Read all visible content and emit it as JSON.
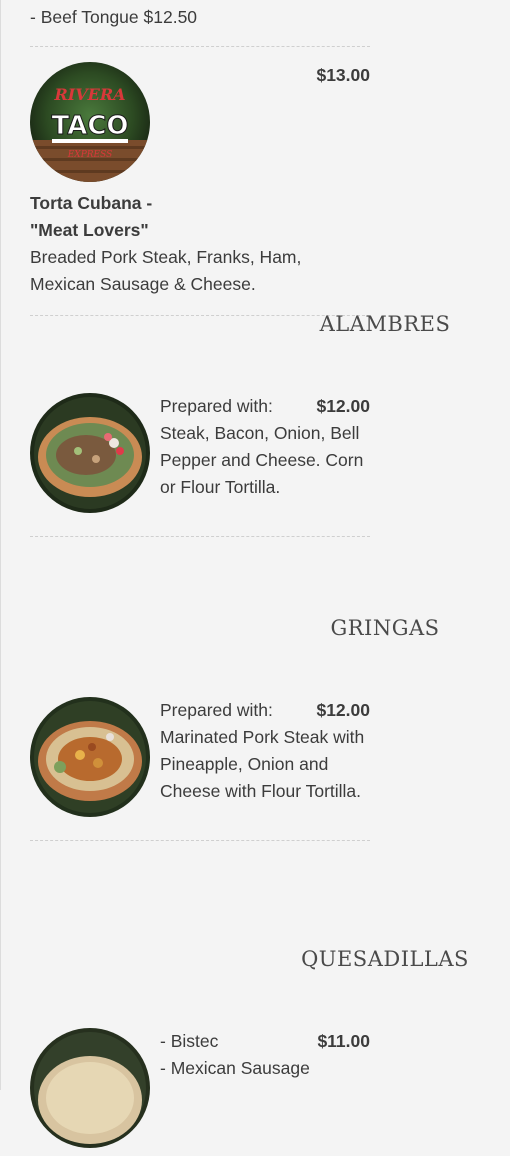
{
  "top_item": {
    "line": "- Beef Tongue $12.50"
  },
  "items": [
    {
      "name": "Torta Cubana - \"Meat Lovers\"",
      "price": "$13.00",
      "description": "Breaded Pork Steak, Franks, Ham, Mexican Sausage & Cheese.",
      "thumb_icon": "rivera-taco-logo-image",
      "logo_text_top": "RIVERA",
      "logo_text_main": "TACO",
      "logo_text_bottom": "EXPRESS"
    },
    {
      "section": "ALAMBRES",
      "price": "$12.00",
      "description": "Prepared with: Steak, Bacon, Onion, Bell Pepper and Cheese. Corn or Flour Tortilla.",
      "thumb_icon": "alambres-plate-image"
    },
    {
      "section": "GRINGAS",
      "price": "$12.00",
      "description": "Prepared with: Marinated Pork Steak with Pineapple, Onion and Cheese with Flour Tortilla.",
      "thumb_icon": "gringas-plate-image"
    },
    {
      "section": "QUESADILLAS",
      "price": "$11.00",
      "description_lines": [
        "- Bistec",
        "- Mexican Sausage"
      ],
      "thumb_icon": "quesadilla-plate-image"
    }
  ]
}
